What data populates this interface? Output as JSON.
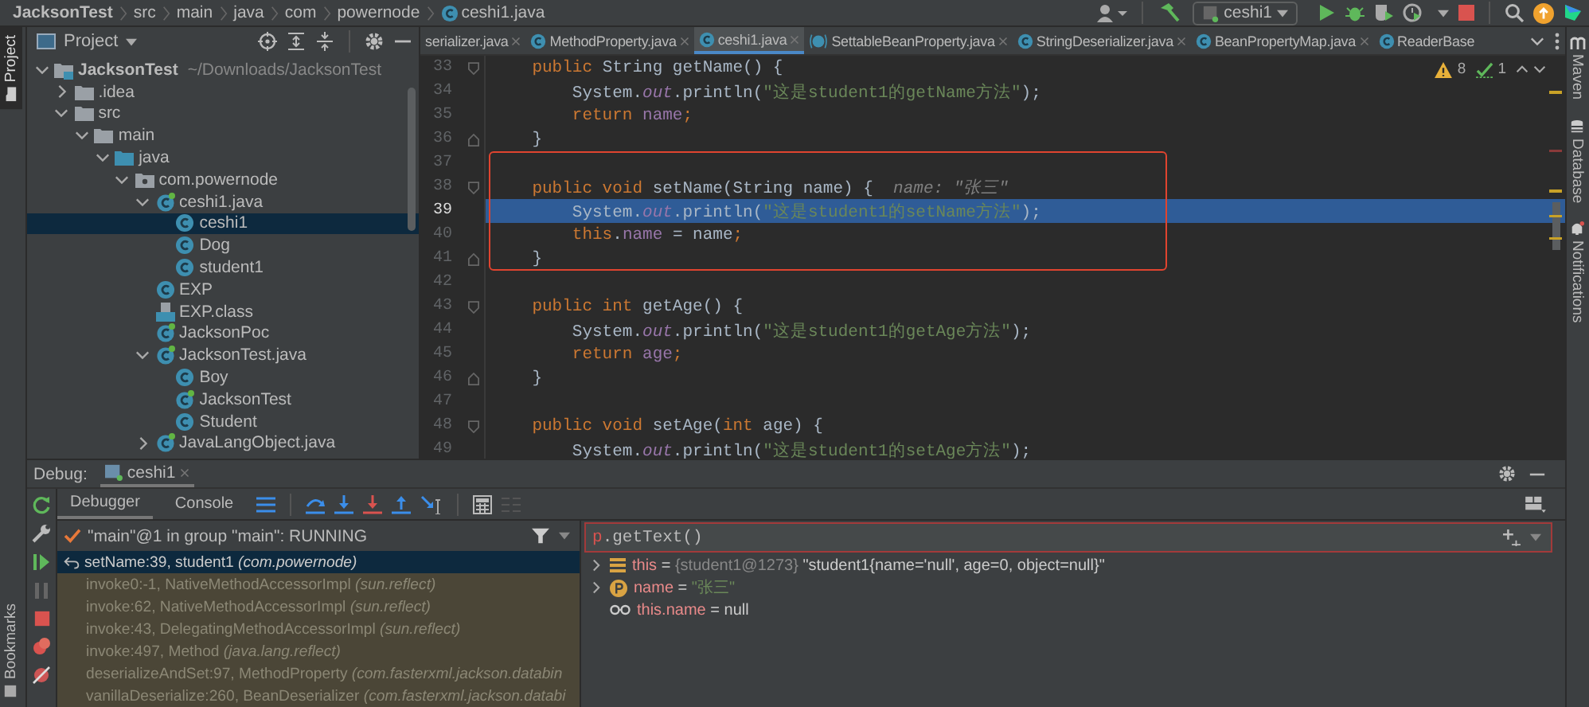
{
  "breadcrumbs": [
    {
      "label": "JacksonTest",
      "kind": "root"
    },
    {
      "label": "src",
      "kind": "dir"
    },
    {
      "label": "main",
      "kind": "dir"
    },
    {
      "label": "java",
      "kind": "dir"
    },
    {
      "label": "com",
      "kind": "dir"
    },
    {
      "label": "powernode",
      "kind": "dir"
    },
    {
      "label": "ceshi1.java",
      "kind": "file"
    }
  ],
  "toolbar": {
    "run_config": "ceshi1"
  },
  "left_strip": {
    "project_tab": "Project",
    "bookmarks_tab": "Bookmarks"
  },
  "project_panel": {
    "title": "Project",
    "tree": [
      {
        "label": "JacksonTest",
        "path": "~/Downloads/JacksonTest",
        "kind": "module",
        "expanded": true,
        "selected": false,
        "children": [
          {
            "label": ".idea",
            "kind": "folder",
            "expanded": false,
            "selected": false
          },
          {
            "label": "src",
            "kind": "folder",
            "expanded": true,
            "selected": false,
            "children": [
              {
                "label": "main",
                "kind": "folder",
                "expanded": true,
                "selected": false,
                "children": [
                  {
                    "label": "java",
                    "kind": "source-folder",
                    "expanded": true,
                    "selected": false,
                    "children": [
                      {
                        "label": "com.powernode",
                        "kind": "package",
                        "expanded": true,
                        "selected": false,
                        "children": [
                          {
                            "label": "ceshi1.java",
                            "kind": "java-file",
                            "expanded": true,
                            "selected": false,
                            "children": [
                              {
                                "label": "ceshi1",
                                "kind": "class",
                                "selected": true
                              },
                              {
                                "label": "Dog",
                                "kind": "class",
                                "selected": false
                              },
                              {
                                "label": "student1",
                                "kind": "class",
                                "selected": false
                              }
                            ]
                          },
                          {
                            "label": "EXP",
                            "kind": "class",
                            "selected": false
                          },
                          {
                            "label": "EXP.class",
                            "kind": "class-file",
                            "selected": false
                          },
                          {
                            "label": "JacksonPoc",
                            "kind": "java-file",
                            "selected": false
                          },
                          {
                            "label": "JacksonTest.java",
                            "kind": "java-file",
                            "expanded": true,
                            "selected": false,
                            "children": [
                              {
                                "label": "Boy",
                                "kind": "class",
                                "selected": false
                              },
                              {
                                "label": "JacksonTest",
                                "kind": "java-file",
                                "selected": false
                              },
                              {
                                "label": "Student",
                                "kind": "class",
                                "selected": false
                              }
                            ]
                          },
                          {
                            "label": "JavaLangObject.java",
                            "kind": "java-file",
                            "expanded": false,
                            "selected": false
                          }
                        ]
                      }
                    ]
                  }
                ]
              }
            ]
          }
        ]
      }
    ]
  },
  "editor": {
    "tabs": [
      {
        "label": "serializer.java",
        "kind": "none",
        "selected": false
      },
      {
        "label": "MethodProperty.java",
        "kind": "class",
        "selected": false
      },
      {
        "label": "ceshi1.java",
        "kind": "class",
        "selected": true
      },
      {
        "label": "SettableBeanProperty.java",
        "kind": "abstract",
        "selected": false
      },
      {
        "label": "StringDeserializer.java",
        "kind": "class",
        "selected": false
      },
      {
        "label": "BeanPropertyMap.java",
        "kind": "class",
        "selected": false
      },
      {
        "label": "ReaderBase",
        "kind": "class",
        "selected": false
      }
    ],
    "inspections": {
      "warnings": "8",
      "typos": "1"
    },
    "lines": [
      {
        "number": "33",
        "kind": "block-start",
        "boxed": false,
        "current": false,
        "tokens": [
          {
            "text": "    public",
            "kind": "kw"
          },
          {
            "text": " String getName() {",
            "kind": "plain"
          }
        ]
      },
      {
        "number": "34",
        "kind": "code",
        "boxed": false,
        "current": false,
        "tokens": [
          {
            "text": "        System.",
            "kind": "plain"
          },
          {
            "text": "out",
            "kind": "static"
          },
          {
            "text": ".println(",
            "kind": "plain"
          },
          {
            "text": "\"这是student1的getName方法\"",
            "kind": "str"
          },
          {
            "text": ");",
            "kind": "plain"
          }
        ]
      },
      {
        "number": "35",
        "kind": "code",
        "boxed": false,
        "current": false,
        "tokens": [
          {
            "text": "        return ",
            "kind": "kw"
          },
          {
            "text": "name",
            "kind": "field"
          },
          {
            "text": ";",
            "kind": "kw"
          }
        ]
      },
      {
        "number": "36",
        "kind": "block-end",
        "boxed": false,
        "current": false,
        "tokens": [
          {
            "text": "    }",
            "kind": "plain"
          }
        ]
      },
      {
        "number": "37",
        "kind": "blank",
        "boxed": true,
        "current": false
      },
      {
        "number": "38",
        "kind": "block-start",
        "boxed": true,
        "current": false,
        "tokens": [
          {
            "text": "    public void",
            "kind": "kw"
          },
          {
            "text": " setName(String name) {",
            "kind": "plain"
          },
          {
            "text": "  name: \"张三\"",
            "kind": "hint"
          }
        ]
      },
      {
        "number": "39",
        "kind": "code",
        "boxed": true,
        "current": true,
        "tokens": [
          {
            "text": "        System.",
            "kind": "plain"
          },
          {
            "text": "out",
            "kind": "static"
          },
          {
            "text": ".println(",
            "kind": "plain"
          },
          {
            "text": "\"这是student1的setName方法\"",
            "kind": "str"
          },
          {
            "text": ");",
            "kind": "plain"
          }
        ]
      },
      {
        "number": "40",
        "kind": "code",
        "boxed": true,
        "current": false,
        "tokens": [
          {
            "text": "        this",
            "kind": "kw"
          },
          {
            "text": ".",
            "kind": "plain"
          },
          {
            "text": "name",
            "kind": "field"
          },
          {
            "text": " = name",
            "kind": "plain"
          },
          {
            "text": ";",
            "kind": "kw"
          }
        ]
      },
      {
        "number": "41",
        "kind": "block-end",
        "boxed": true,
        "current": false,
        "tokens": [
          {
            "text": "    }",
            "kind": "plain"
          }
        ]
      },
      {
        "number": "42",
        "kind": "blank",
        "boxed": false,
        "current": false
      },
      {
        "number": "43",
        "kind": "block-start",
        "boxed": false,
        "current": false,
        "tokens": [
          {
            "text": "    public int",
            "kind": "kw"
          },
          {
            "text": " getAge() {",
            "kind": "plain"
          }
        ]
      },
      {
        "number": "44",
        "kind": "code",
        "boxed": false,
        "current": false,
        "tokens": [
          {
            "text": "        System.",
            "kind": "plain"
          },
          {
            "text": "out",
            "kind": "static"
          },
          {
            "text": ".println(",
            "kind": "plain"
          },
          {
            "text": "\"这是student1的getAge方法\"",
            "kind": "str"
          },
          {
            "text": ");",
            "kind": "plain"
          }
        ]
      },
      {
        "number": "45",
        "kind": "code",
        "boxed": false,
        "current": false,
        "tokens": [
          {
            "text": "        return ",
            "kind": "kw"
          },
          {
            "text": "age",
            "kind": "field"
          },
          {
            "text": ";",
            "kind": "kw"
          }
        ]
      },
      {
        "number": "46",
        "kind": "block-end",
        "boxed": false,
        "current": false,
        "tokens": [
          {
            "text": "    }",
            "kind": "plain"
          }
        ]
      },
      {
        "number": "47",
        "kind": "blank",
        "boxed": false,
        "current": false
      },
      {
        "number": "48",
        "kind": "block-start",
        "boxed": false,
        "current": false,
        "tokens": [
          {
            "text": "    public void",
            "kind": "kw"
          },
          {
            "text": " setAge(",
            "kind": "plain"
          },
          {
            "text": "int",
            "kind": "kw"
          },
          {
            "text": " age) {",
            "kind": "plain"
          }
        ]
      },
      {
        "number": "49",
        "kind": "code",
        "boxed": false,
        "current": false,
        "tokens": [
          {
            "text": "        System.",
            "kind": "plain"
          },
          {
            "text": "out",
            "kind": "static"
          },
          {
            "text": ".println(",
            "kind": "plain"
          },
          {
            "text": "\"这是student1的setAge方法\"",
            "kind": "str"
          },
          {
            "text": ");",
            "kind": "plain"
          }
        ]
      }
    ]
  },
  "right_strip": [
    {
      "label": "Maven",
      "kind": "maven"
    },
    {
      "label": "Database",
      "kind": "database"
    },
    {
      "label": "Notifications",
      "kind": "bell"
    }
  ],
  "debug": {
    "label": "Debug:",
    "session_tab": "ceshi1",
    "tabs": [
      {
        "label": "Debugger",
        "selected": true
      },
      {
        "label": "Console",
        "selected": false
      }
    ],
    "thread": "\"main\"@1 in group \"main\": RUNNING",
    "frames": [
      {
        "text": "setName:39, student1 *(com.powernode)*",
        "kind": "user",
        "selected": true
      },
      {
        "text": "invoke0:-1, NativeMethodAccessorImpl *(sun.reflect)*",
        "kind": "library",
        "selected": false
      },
      {
        "text": "invoke:62, NativeMethodAccessorImpl *(sun.reflect)*",
        "kind": "library",
        "selected": false
      },
      {
        "text": "invoke:43, DelegatingMethodAccessorImpl *(sun.reflect)*",
        "kind": "library",
        "selected": false
      },
      {
        "text": "invoke:497, Method *(java.lang.reflect)*",
        "kind": "library",
        "selected": false
      },
      {
        "text": "deserializeAndSet:97, MethodProperty *(com.fasterxml.jackson.databin*",
        "kind": "library",
        "selected": false
      },
      {
        "text": "vanillaDeserialize:260, BeanDeserializer *(com.fasterxml.jackson.databi*",
        "kind": "library",
        "selected": false
      }
    ],
    "expression": [
      {
        "text": "p",
        "kind": "error"
      },
      {
        "text": ".getText()",
        "kind": "plain"
      }
    ],
    "variables": [
      {
        "expanded": false,
        "kind": "field",
        "tokens": [
          {
            "text": "this",
            "kind": "name"
          },
          {
            "text": " = ",
            "kind": "plain"
          },
          {
            "text": "{student1@1273}",
            "kind": "ref"
          },
          {
            "text": " \"student1{name='null', age=0, object=null}\"",
            "kind": "plain"
          }
        ]
      },
      {
        "expanded": false,
        "kind": "param",
        "tokens": [
          {
            "text": "name",
            "kind": "name"
          },
          {
            "text": " = ",
            "kind": "plain"
          },
          {
            "text": "\"张三\"",
            "kind": "str"
          }
        ]
      },
      {
        "kind": "watch",
        "tokens": [
          {
            "text": "this.name",
            "kind": "name"
          },
          {
            "text": " = null",
            "kind": "plain"
          }
        ]
      }
    ]
  }
}
